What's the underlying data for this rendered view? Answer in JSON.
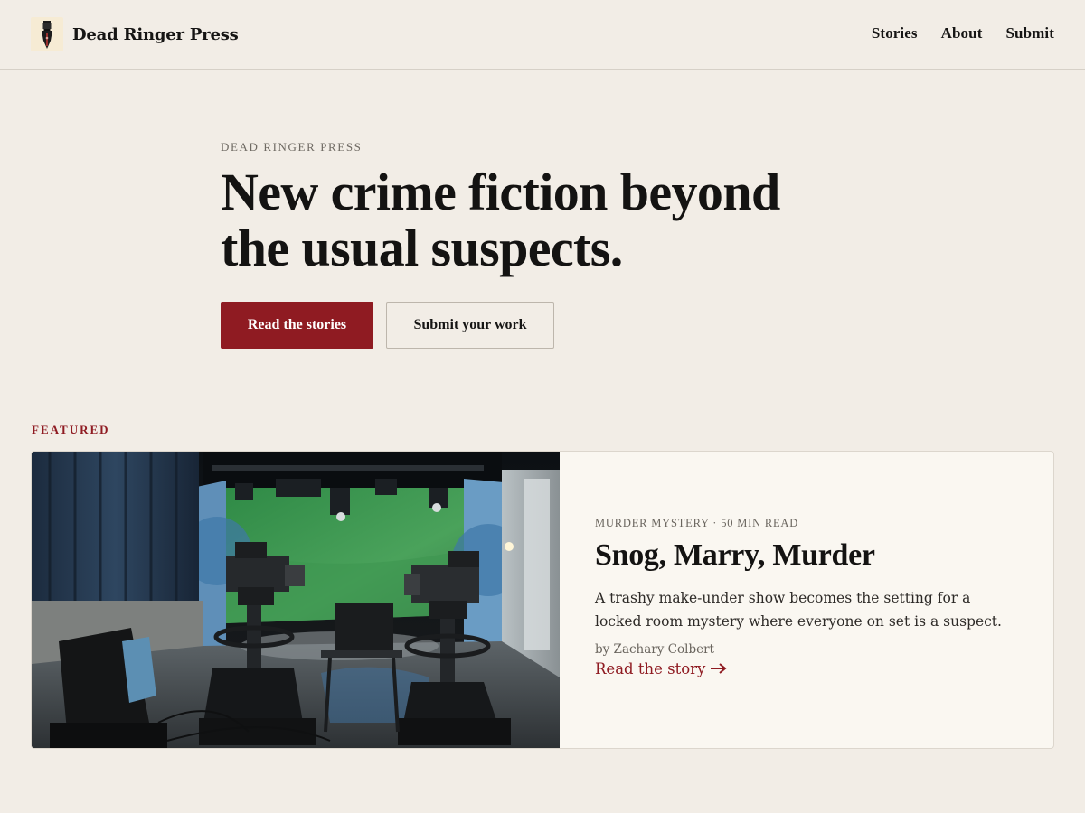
{
  "header": {
    "brand": "Dead Ringer Press",
    "logo_icon": "fountain-pen-nib-icon",
    "nav": [
      {
        "label": "Stories"
      },
      {
        "label": "About"
      },
      {
        "label": "Submit"
      }
    ]
  },
  "hero": {
    "kicker": "DEAD RINGER PRESS",
    "title_line1": "New crime fiction beyond",
    "title_line2": "the usual suspects.",
    "primary_cta": "Read the stories",
    "secondary_cta": "Submit your work"
  },
  "featured": {
    "label": "FEATURED",
    "meta": "MURDER MYSTERY · 50 MIN READ",
    "title": "Snog, Marry, Murder",
    "excerpt": "A trashy make-under show becomes the setting for a locked room mystery where everyone on set is a suspect.",
    "byline": "by Zachary Colbert",
    "link_label": "Read the story",
    "link_icon": "arrow-right-icon",
    "image_icon": "tv-studio-photo"
  },
  "colors": {
    "background": "#f2ede6",
    "accent": "#8f1b22",
    "card": "#faf7f1"
  }
}
